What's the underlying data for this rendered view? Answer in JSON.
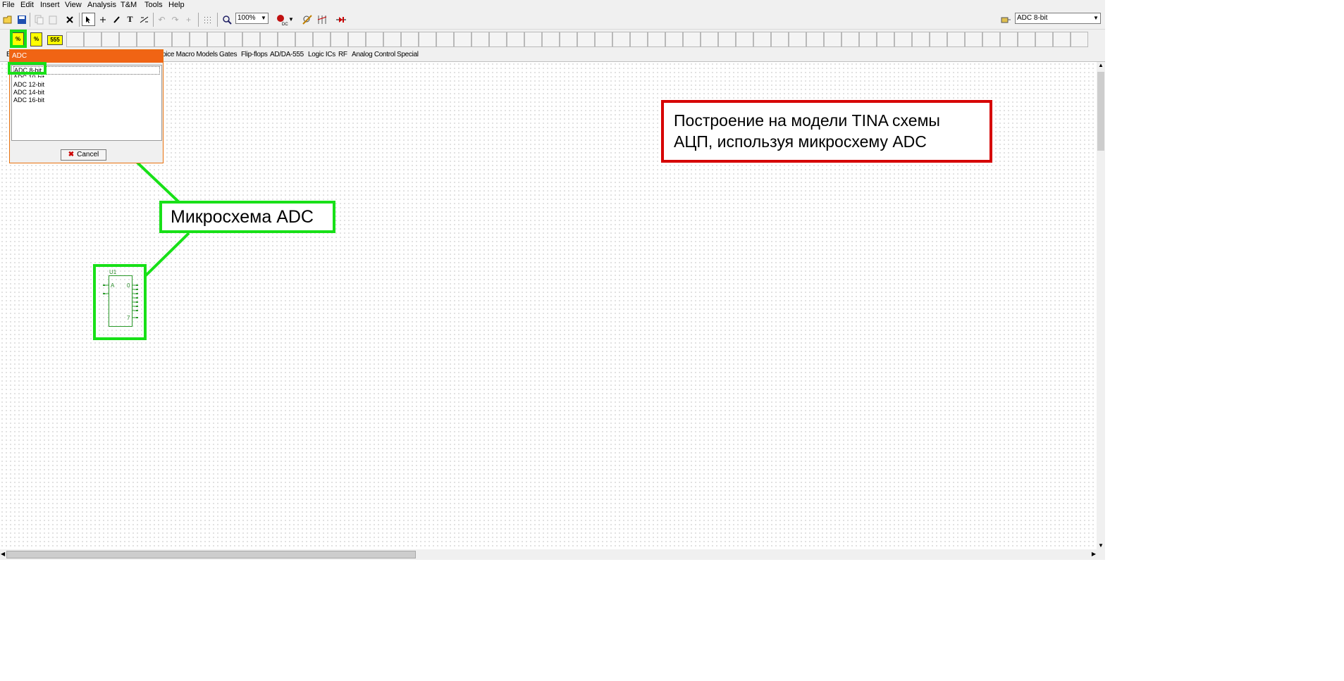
{
  "menu": [
    "File",
    "Edit",
    "Insert",
    "View",
    "Analysis",
    "T&M",
    "Tools",
    "Help"
  ],
  "toolbar": {
    "zoom": "100%",
    "component_select": "ADC 8-bit",
    "text_tool": "T",
    "delete_icon": "close-icon"
  },
  "parts": {
    "icon1": "%",
    "icon2": "%",
    "icon3": "555"
  },
  "tabs": [
    "B",
    "pice Macro Models",
    "Gates",
    "Flip-flops",
    "AD/DA-555",
    "Logic ICs",
    "RF",
    "Analog Control",
    "Special"
  ],
  "dialog": {
    "title": "ADC",
    "items": [
      "ADC 8-bit",
      "ADC 10-bit",
      "ADC 12-bit",
      "ADC 14-bit",
      "ADC 16-bit"
    ],
    "selected_index": 0,
    "cancel": "Cancel"
  },
  "annotations": {
    "red_line1": "Построение на модели TINA схемы",
    "red_line2": "АЦП, используя микросхему ADC",
    "green_label": "Микросхема ADC"
  },
  "ic": {
    "ref": "U1",
    "pin_in": "A",
    "pin_out_first": "0",
    "pin_out_last": "7"
  },
  "colors": {
    "red_annotation": "#d60000",
    "green_annotation": "#18e018",
    "dialog_title": "#f06414",
    "component": "#2a9a2a"
  }
}
